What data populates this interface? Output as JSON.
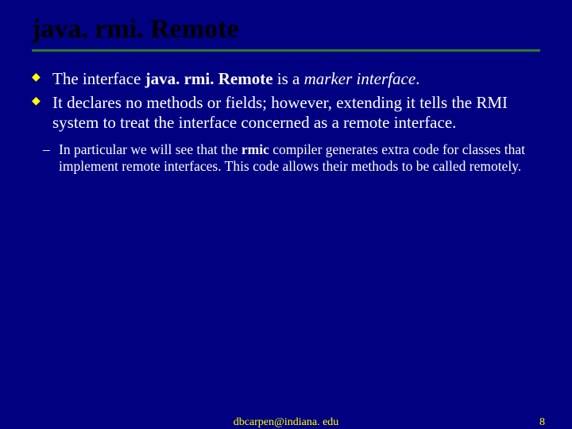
{
  "title": "java. rmi. Remote",
  "bullets": [
    {
      "pre": "The interface ",
      "boldA": "java. rmi. Remote",
      "mid": " is a ",
      "italic": "marker interface",
      "post": "."
    },
    {
      "text": "It declares no methods or fields; however, extending it tells the RMI system to treat the interface concerned as a remote interface."
    }
  ],
  "sub": {
    "pre": "In particular we will see that the ",
    "bold": "rmic",
    "post": " compiler generates extra code for classes that implement remote interfaces.  This code allows their methods to be called remotely."
  },
  "footer": {
    "email": "dbcarpen@indiana. edu",
    "page": "8"
  }
}
